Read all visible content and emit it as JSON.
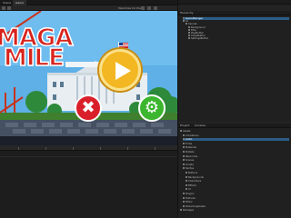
{
  "game_view": {
    "tabs": [
      {
        "label": "Scene"
      },
      {
        "label": "Game"
      }
    ],
    "title_line1": "MAGA",
    "title_line2": "MILE",
    "status": "",
    "toolbar_text": "Maximize On Play"
  },
  "hierarchy": {
    "header": "Hierarchy",
    "items": [
      "GameManager",
      "UI",
      "Canvas",
      "Background",
      "Title",
      "PlayButton",
      "CloseButton",
      "SettingsButton"
    ]
  },
  "project": {
    "header_tabs": [
      "Project",
      "Console"
    ],
    "items": [
      "Assets",
      "Animations",
      "Audio",
      "Fonts",
      "Materials",
      "Prefabs",
      "Resources",
      "Scenes",
      "Scripts",
      "Sprites",
      "Buttons",
      "Backgrounds",
      "Characters",
      "Effects",
      "UI",
      "Plugins",
      "Textures",
      "Editor",
      "StreamingAssets",
      "Packages"
    ]
  },
  "colors": {
    "sky": "#5eb0e6",
    "title_red": "#d8231c",
    "play_yellow": "#f2b722",
    "close_red": "#d9202a",
    "settings_green": "#3cb52f"
  }
}
